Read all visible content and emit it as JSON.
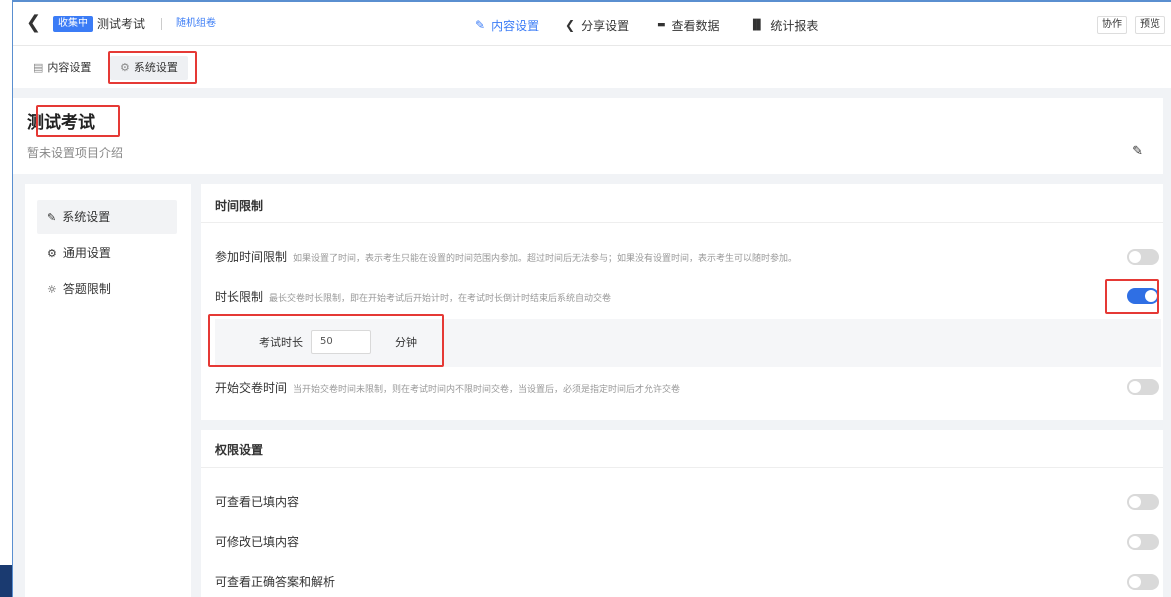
{
  "header": {
    "back_icon": "chevron-left-icon",
    "status_badge": "收集中",
    "title": "测试考试",
    "mode": "随机组卷",
    "nav": [
      {
        "label": "内容设置",
        "icon": "pen-icon",
        "active": true
      },
      {
        "label": "分享设置",
        "icon": "share-icon",
        "active": false
      },
      {
        "label": "查看数据",
        "icon": "data-icon",
        "active": false
      },
      {
        "label": "统计报表",
        "icon": "bar-chart-icon",
        "active": false
      }
    ],
    "collab_label": "协作",
    "preview_label": "预览"
  },
  "subtabs": [
    {
      "label": "内容设置",
      "icon": "document-icon",
      "active": false
    },
    {
      "label": "系统设置",
      "icon": "gear-icon",
      "active": true
    }
  ],
  "intro": {
    "title": "测试考试",
    "description": "暂未设置项目介绍"
  },
  "sidebar": {
    "items": [
      {
        "label": "系统设置",
        "icon": "pen-icon",
        "active": true
      },
      {
        "label": "通用设置",
        "icon": "gear-icon",
        "active": false
      },
      {
        "label": "答题限制",
        "icon": "sun-icon",
        "active": false
      }
    ]
  },
  "time_limit": {
    "title": "时间限制",
    "rows": [
      {
        "label": "参加时间限制",
        "hint": "如果设置了时间，表示考生只能在设置的时间范围内参加。超过时间后无法参与；如果没有设置时间，表示考生可以随时参加。",
        "enabled": false
      },
      {
        "label": "时长限制",
        "hint": "最长交卷时长限制，即在开始考试后开始计时，在考试时长倒计时结束后系统自动交卷",
        "enabled": true
      },
      {
        "label": "开始交卷时间",
        "hint": "当开始交卷时间未限制，则在考试时间内不限时间交卷，当设置后，必须是指定时间后才允许交卷",
        "enabled": false
      }
    ],
    "duration": {
      "label": "考试时长",
      "value": "50",
      "unit": "分钟"
    }
  },
  "permissions": {
    "title": "权限设置",
    "rows": [
      {
        "label": "可查看已填内容",
        "enabled": false
      },
      {
        "label": "可修改已填内容",
        "enabled": false
      },
      {
        "label": "可查看正确答案和解析",
        "enabled": false
      }
    ]
  },
  "colors": {
    "accent": "#3b7cf6",
    "highlight_box": "#e53935",
    "toggle_on": "#2f6fe4",
    "toggle_off": "#d9d9d9"
  }
}
